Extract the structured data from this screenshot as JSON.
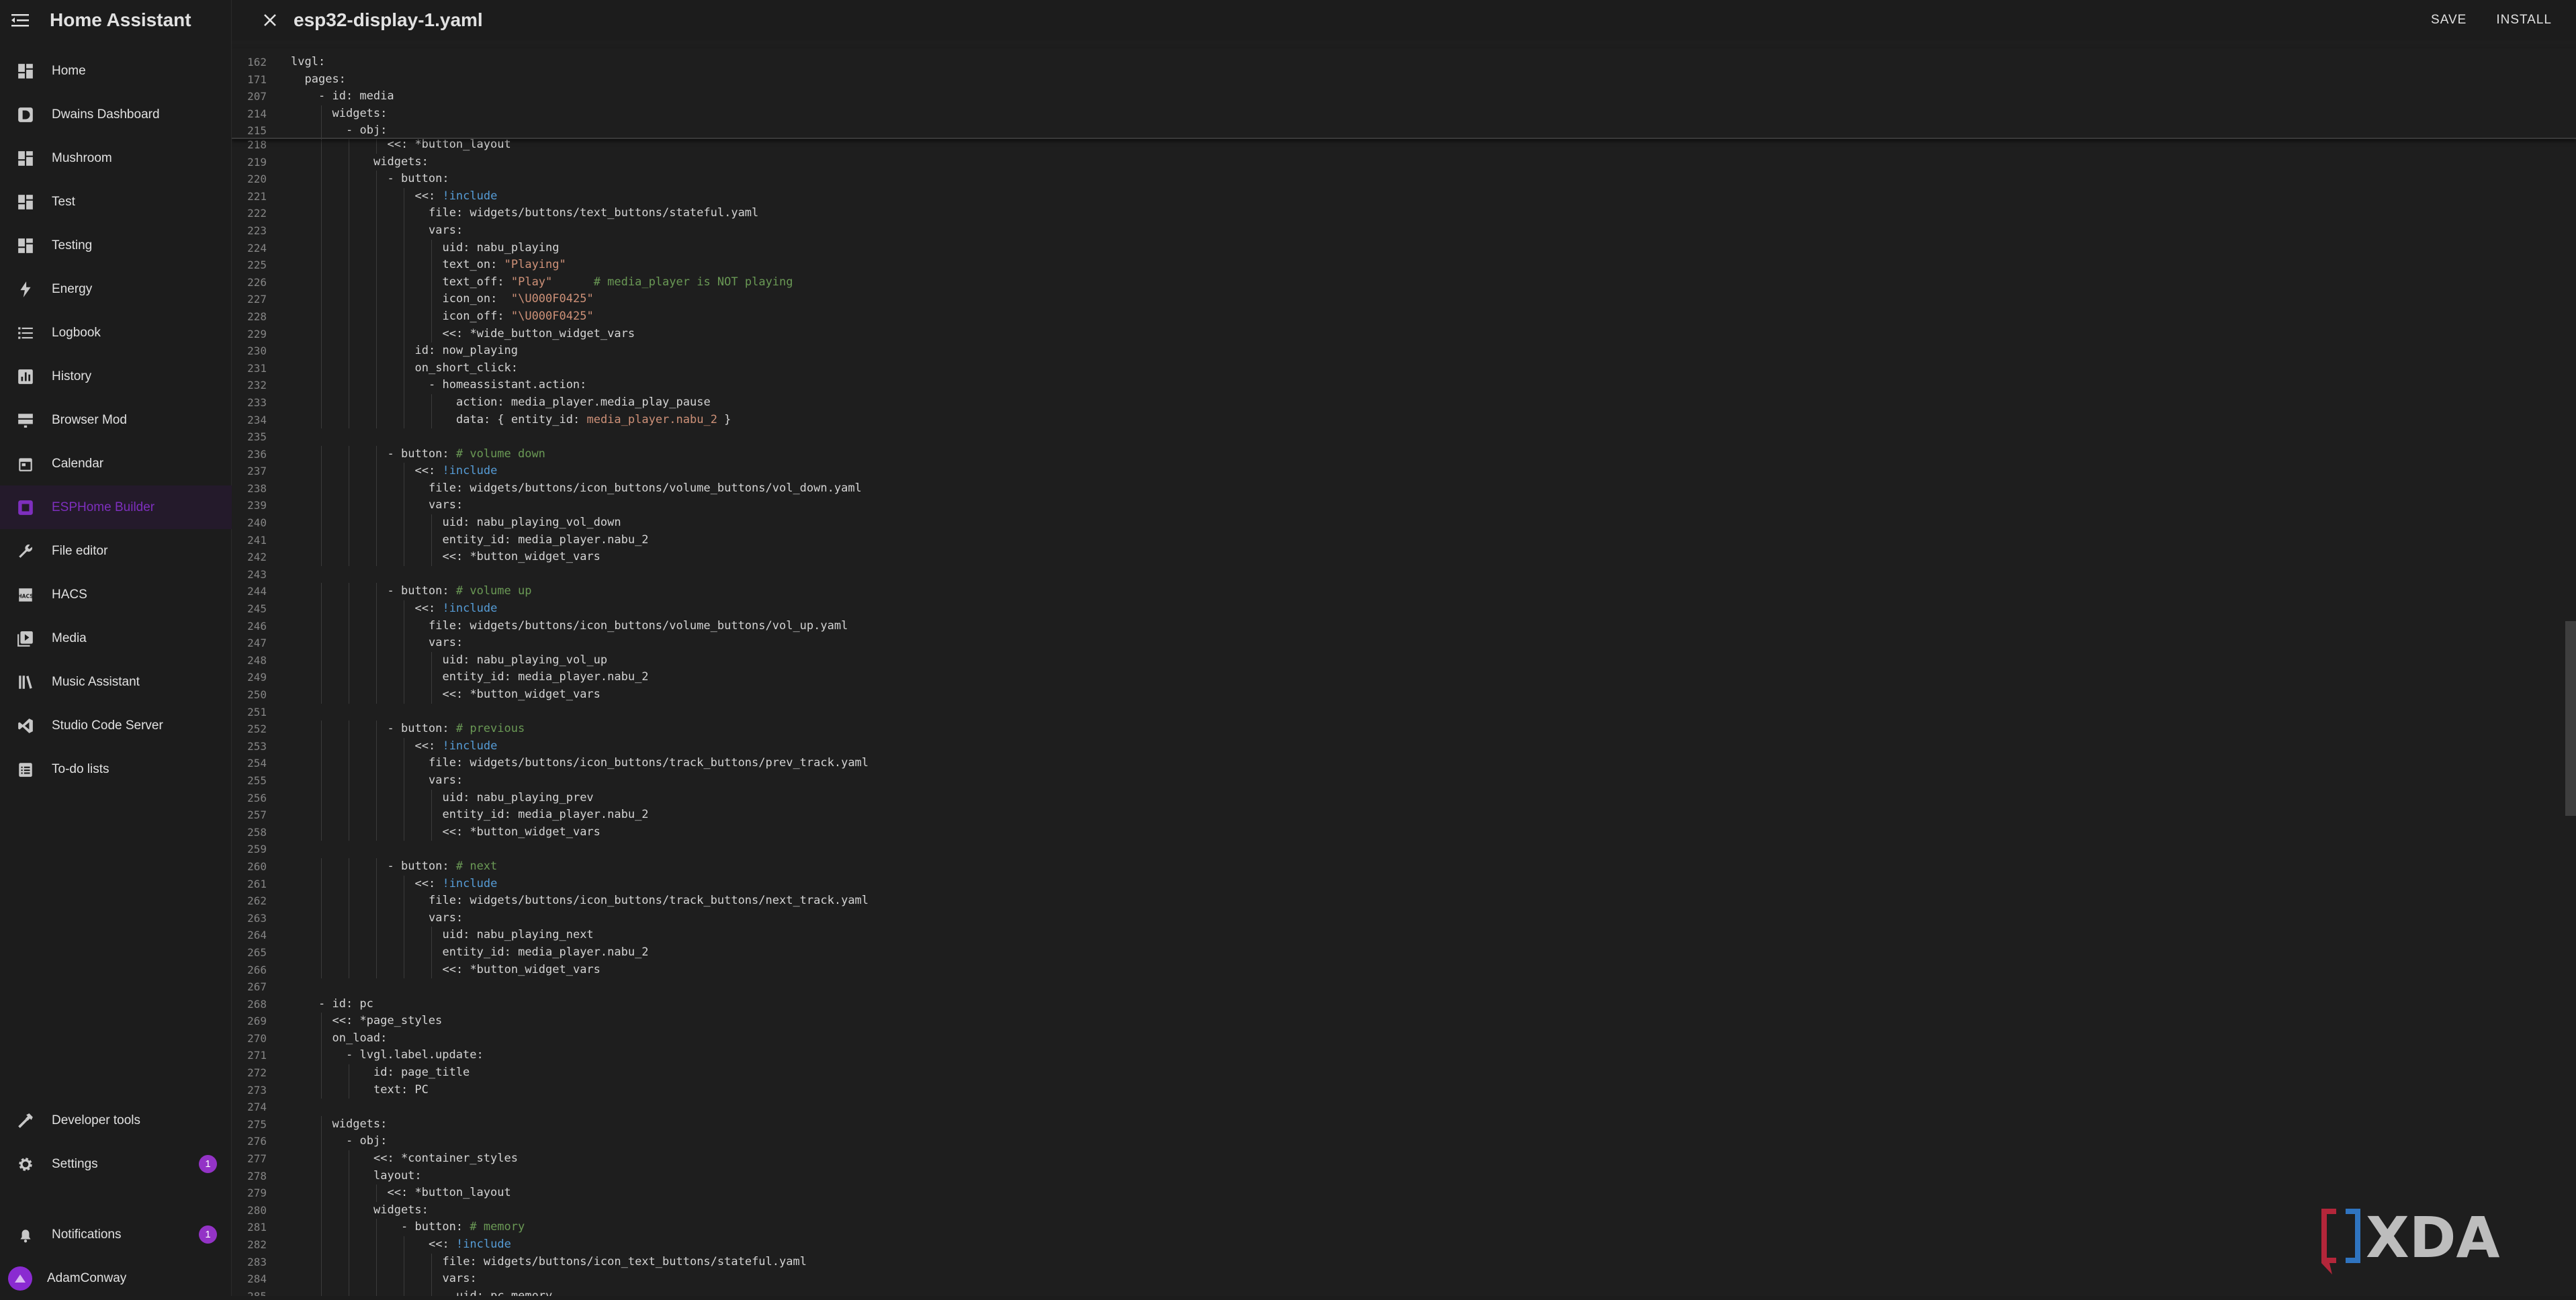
{
  "sidebar": {
    "title": "Home Assistant",
    "items": [
      {
        "label": "Home",
        "icon": "view-dashboard-icon"
      },
      {
        "label": "Dwains Dashboard",
        "icon": "d-box-icon"
      },
      {
        "label": "Mushroom",
        "icon": "view-dashboard-icon"
      },
      {
        "label": "Test",
        "icon": "view-dashboard-icon"
      },
      {
        "label": "Testing",
        "icon": "view-dashboard-icon"
      },
      {
        "label": "Energy",
        "icon": "lightning-bolt-icon"
      },
      {
        "label": "Logbook",
        "icon": "format-list-icon"
      },
      {
        "label": "History",
        "icon": "chart-box-icon"
      },
      {
        "label": "Browser Mod",
        "icon": "server-icon"
      },
      {
        "label": "Calendar",
        "icon": "calendar-icon"
      },
      {
        "label": "ESPHome Builder",
        "icon": "esphome-icon",
        "active": true
      },
      {
        "label": "File editor",
        "icon": "wrench-icon"
      },
      {
        "label": "HACS",
        "icon": "hacs-icon"
      },
      {
        "label": "Media",
        "icon": "play-box-icon"
      },
      {
        "label": "Music Assistant",
        "icon": "library-music-icon"
      },
      {
        "label": "Studio Code Server",
        "icon": "vscode-icon"
      },
      {
        "label": "To-do lists",
        "icon": "clipboard-list-icon"
      }
    ],
    "bottom": {
      "developer_tools": "Developer tools",
      "settings": "Settings",
      "settings_badge": "1",
      "notifications": "Notifications",
      "notifications_badge": "1",
      "user": "AdamConway"
    },
    "accent_color": "#7e2fbe"
  },
  "editor": {
    "file_title": "esp32-display-1.yaml",
    "save_label": "SAVE",
    "install_label": "INSTALL",
    "sticky_lines": [
      {
        "n": "162",
        "i": 0,
        "t": [
          [
            "k",
            "lvgl:"
          ]
        ]
      },
      {
        "n": "171",
        "i": 1,
        "t": [
          [
            "k",
            "pages:"
          ]
        ]
      },
      {
        "n": "207",
        "i": 2,
        "t": [
          [
            "k",
            "- id: media"
          ]
        ]
      },
      {
        "n": "214",
        "i": 3,
        "t": [
          [
            "k",
            "widgets:"
          ]
        ]
      },
      {
        "n": "215",
        "i": 4,
        "t": [
          [
            "k",
            "- obj:"
          ]
        ]
      }
    ],
    "lines": [
      {
        "n": "218",
        "i": 7,
        "t": [
          [
            "k",
            "<<: *button_layout"
          ]
        ]
      },
      {
        "n": "219",
        "i": 6,
        "t": [
          [
            "k",
            "widgets:"
          ]
        ]
      },
      {
        "n": "220",
        "i": 7,
        "t": [
          [
            "k",
            "- button:"
          ]
        ]
      },
      {
        "n": "221",
        "i": 9,
        "t": [
          [
            "k",
            "<<: "
          ],
          [
            "tag",
            "!include"
          ]
        ]
      },
      {
        "n": "222",
        "i": 10,
        "t": [
          [
            "k",
            "file: widgets/buttons/text_buttons/stateful.yaml"
          ]
        ]
      },
      {
        "n": "223",
        "i": 10,
        "t": [
          [
            "k",
            "vars:"
          ]
        ]
      },
      {
        "n": "224",
        "i": 11,
        "t": [
          [
            "k",
            "uid: nabu_playing"
          ]
        ]
      },
      {
        "n": "225",
        "i": 11,
        "t": [
          [
            "k",
            "text_on: "
          ],
          [
            "str",
            "\"Playing\""
          ]
        ]
      },
      {
        "n": "226",
        "i": 11,
        "t": [
          [
            "k",
            "text_off: "
          ],
          [
            "str",
            "\"Play\""
          ],
          [
            "k",
            "      "
          ],
          [
            "com",
            "# media_player is NOT playing"
          ]
        ]
      },
      {
        "n": "227",
        "i": 11,
        "t": [
          [
            "k",
            "icon_on:  "
          ],
          [
            "str",
            "\"\\U000F0425\""
          ]
        ]
      },
      {
        "n": "228",
        "i": 11,
        "t": [
          [
            "k",
            "icon_off: "
          ],
          [
            "str",
            "\"\\U000F0425\""
          ]
        ]
      },
      {
        "n": "229",
        "i": 11,
        "t": [
          [
            "k",
            "<<: *wide_button_widget_vars"
          ]
        ]
      },
      {
        "n": "230",
        "i": 9,
        "t": [
          [
            "k",
            "id: now_playing"
          ]
        ]
      },
      {
        "n": "231",
        "i": 9,
        "t": [
          [
            "k",
            "on_short_click:"
          ]
        ]
      },
      {
        "n": "232",
        "i": 10,
        "t": [
          [
            "k",
            "- homeassistant.action:"
          ]
        ]
      },
      {
        "n": "233",
        "i": 12,
        "t": [
          [
            "k",
            "action: media_player.media_play_pause"
          ]
        ]
      },
      {
        "n": "234",
        "i": 12,
        "t": [
          [
            "k",
            "data: { entity_id: "
          ],
          [
            "str",
            "media_player.nabu_2"
          ],
          [
            "k",
            " }"
          ]
        ]
      },
      {
        "n": "235",
        "i": 0,
        "t": []
      },
      {
        "n": "236",
        "i": 7,
        "t": [
          [
            "k",
            "- button: "
          ],
          [
            "com",
            "# volume down"
          ]
        ]
      },
      {
        "n": "237",
        "i": 9,
        "t": [
          [
            "k",
            "<<: "
          ],
          [
            "tag",
            "!include"
          ]
        ]
      },
      {
        "n": "238",
        "i": 10,
        "t": [
          [
            "k",
            "file: widgets/buttons/icon_buttons/volume_buttons/vol_down.yaml"
          ]
        ]
      },
      {
        "n": "239",
        "i": 10,
        "t": [
          [
            "k",
            "vars:"
          ]
        ]
      },
      {
        "n": "240",
        "i": 11,
        "t": [
          [
            "k",
            "uid: nabu_playing_vol_down"
          ]
        ]
      },
      {
        "n": "241",
        "i": 11,
        "t": [
          [
            "k",
            "entity_id: media_player.nabu_2"
          ]
        ]
      },
      {
        "n": "242",
        "i": 11,
        "t": [
          [
            "k",
            "<<: *button_widget_vars"
          ]
        ]
      },
      {
        "n": "243",
        "i": 0,
        "t": []
      },
      {
        "n": "244",
        "i": 7,
        "t": [
          [
            "k",
            "- button: "
          ],
          [
            "com",
            "# volume up"
          ]
        ]
      },
      {
        "n": "245",
        "i": 9,
        "t": [
          [
            "k",
            "<<: "
          ],
          [
            "tag",
            "!include"
          ]
        ]
      },
      {
        "n": "246",
        "i": 10,
        "t": [
          [
            "k",
            "file: widgets/buttons/icon_buttons/volume_buttons/vol_up.yaml"
          ]
        ]
      },
      {
        "n": "247",
        "i": 10,
        "t": [
          [
            "k",
            "vars:"
          ]
        ]
      },
      {
        "n": "248",
        "i": 11,
        "t": [
          [
            "k",
            "uid: nabu_playing_vol_up"
          ]
        ]
      },
      {
        "n": "249",
        "i": 11,
        "t": [
          [
            "k",
            "entity_id: media_player.nabu_2"
          ]
        ]
      },
      {
        "n": "250",
        "i": 11,
        "t": [
          [
            "k",
            "<<: *button_widget_vars"
          ]
        ]
      },
      {
        "n": "251",
        "i": 0,
        "t": []
      },
      {
        "n": "252",
        "i": 7,
        "t": [
          [
            "k",
            "- button: "
          ],
          [
            "com",
            "# previous"
          ]
        ]
      },
      {
        "n": "253",
        "i": 9,
        "t": [
          [
            "k",
            "<<: "
          ],
          [
            "tag",
            "!include"
          ]
        ]
      },
      {
        "n": "254",
        "i": 10,
        "t": [
          [
            "k",
            "file: widgets/buttons/icon_buttons/track_buttons/prev_track.yaml"
          ]
        ]
      },
      {
        "n": "255",
        "i": 10,
        "t": [
          [
            "k",
            "vars:"
          ]
        ]
      },
      {
        "n": "256",
        "i": 11,
        "t": [
          [
            "k",
            "uid: nabu_playing_prev"
          ]
        ]
      },
      {
        "n": "257",
        "i": 11,
        "t": [
          [
            "k",
            "entity_id: media_player.nabu_2"
          ]
        ]
      },
      {
        "n": "258",
        "i": 11,
        "t": [
          [
            "k",
            "<<: *button_widget_vars"
          ]
        ]
      },
      {
        "n": "259",
        "i": 0,
        "t": []
      },
      {
        "n": "260",
        "i": 7,
        "t": [
          [
            "k",
            "- button: "
          ],
          [
            "com",
            "# next"
          ]
        ]
      },
      {
        "n": "261",
        "i": 9,
        "t": [
          [
            "k",
            "<<: "
          ],
          [
            "tag",
            "!include"
          ]
        ]
      },
      {
        "n": "262",
        "i": 10,
        "t": [
          [
            "k",
            "file: widgets/buttons/icon_buttons/track_buttons/next_track.yaml"
          ]
        ]
      },
      {
        "n": "263",
        "i": 10,
        "t": [
          [
            "k",
            "vars:"
          ]
        ]
      },
      {
        "n": "264",
        "i": 11,
        "t": [
          [
            "k",
            "uid: nabu_playing_next"
          ]
        ]
      },
      {
        "n": "265",
        "i": 11,
        "t": [
          [
            "k",
            "entity_id: media_player.nabu_2"
          ]
        ]
      },
      {
        "n": "266",
        "i": 11,
        "t": [
          [
            "k",
            "<<: *button_widget_vars"
          ]
        ]
      },
      {
        "n": "267",
        "i": 0,
        "t": []
      },
      {
        "n": "268",
        "i": 2,
        "t": [
          [
            "k",
            "- id: pc"
          ]
        ]
      },
      {
        "n": "269",
        "i": 3,
        "t": [
          [
            "k",
            "<<: *page_styles"
          ]
        ]
      },
      {
        "n": "270",
        "i": 3,
        "t": [
          [
            "k",
            "on_load:"
          ]
        ]
      },
      {
        "n": "271",
        "i": 4,
        "t": [
          [
            "k",
            "- lvgl.label.update:"
          ]
        ]
      },
      {
        "n": "272",
        "i": 6,
        "t": [
          [
            "k",
            "id: page_title"
          ]
        ]
      },
      {
        "n": "273",
        "i": 6,
        "t": [
          [
            "k",
            "text: PC"
          ]
        ]
      },
      {
        "n": "274",
        "i": 0,
        "t": []
      },
      {
        "n": "275",
        "i": 3,
        "t": [
          [
            "k",
            "widgets:"
          ]
        ]
      },
      {
        "n": "276",
        "i": 4,
        "t": [
          [
            "k",
            "- obj:"
          ]
        ]
      },
      {
        "n": "277",
        "i": 6,
        "t": [
          [
            "k",
            "<<: *container_styles"
          ]
        ]
      },
      {
        "n": "278",
        "i": 6,
        "t": [
          [
            "k",
            "layout:"
          ]
        ]
      },
      {
        "n": "279",
        "i": 7,
        "t": [
          [
            "k",
            "<<: *button_layout"
          ]
        ]
      },
      {
        "n": "280",
        "i": 6,
        "t": [
          [
            "k",
            "widgets:"
          ]
        ]
      },
      {
        "n": "281",
        "i": 8,
        "t": [
          [
            "k",
            "- button: "
          ],
          [
            "com",
            "# memory"
          ]
        ]
      },
      {
        "n": "282",
        "i": 10,
        "t": [
          [
            "k",
            "<<: "
          ],
          [
            "tag",
            "!include"
          ]
        ]
      },
      {
        "n": "283",
        "i": 11,
        "t": [
          [
            "k",
            "file: widgets/buttons/icon_text_buttons/stateful.yaml"
          ]
        ]
      },
      {
        "n": "284",
        "i": 11,
        "t": [
          [
            "k",
            "vars:"
          ]
        ]
      },
      {
        "n": "285",
        "i": 12,
        "t": [
          [
            "k",
            "uid: pc_memory"
          ]
        ]
      }
    ]
  },
  "watermark": {
    "brand": "XDA",
    "icon": "xda-logo-icon"
  }
}
